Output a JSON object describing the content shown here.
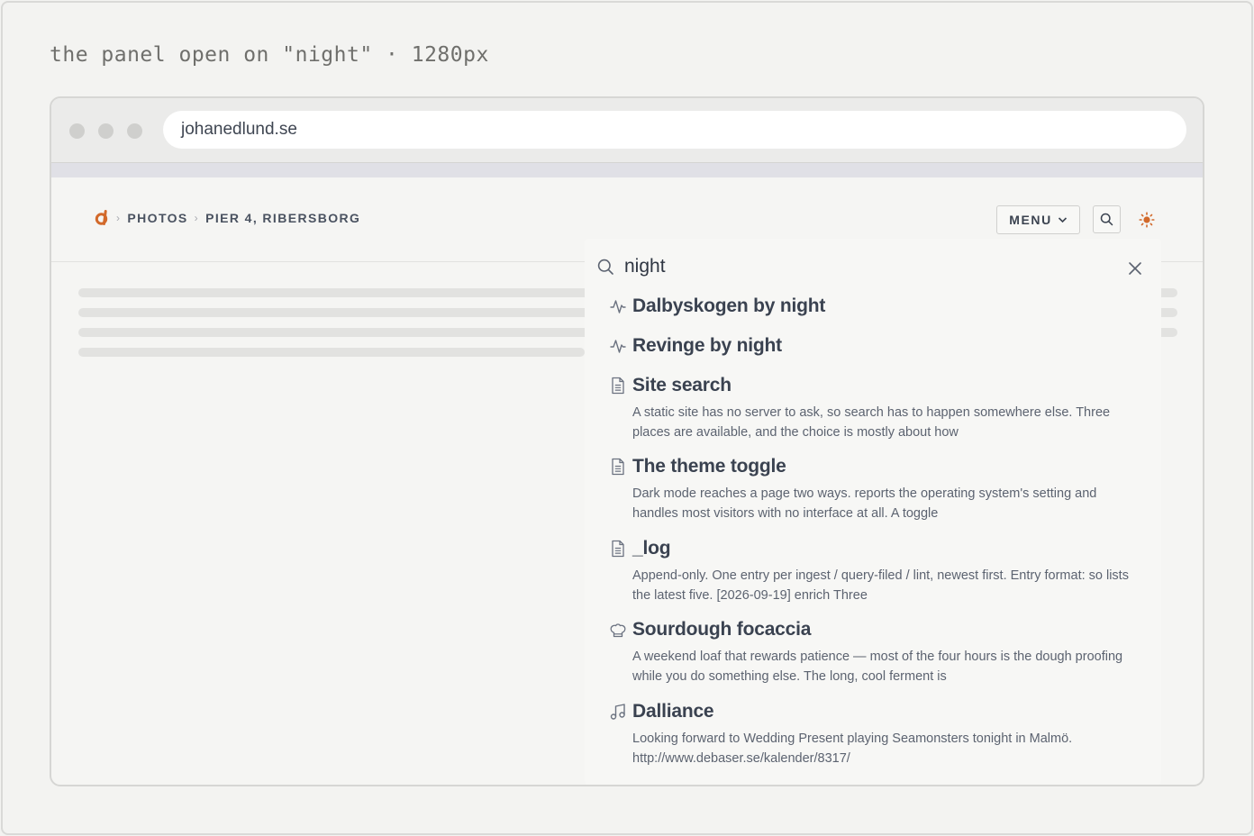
{
  "caption": "the panel open on \"night\" · 1280px",
  "browser": {
    "url": "johanedlund.se"
  },
  "header": {
    "breadcrumbs": [
      "PHOTOS",
      "PIER 4, RIBERSBORG"
    ],
    "menu_label": "MENU",
    "accent_color": "#d2692a"
  },
  "search": {
    "query": "night",
    "results": [
      {
        "icon": "activity-icon",
        "title": "Dalbyskogen by night",
        "description": ""
      },
      {
        "icon": "activity-icon",
        "title": "Revinge by night",
        "description": ""
      },
      {
        "icon": "document-icon",
        "title": "Site search",
        "description": "A static site has no server to ask, so search has to happen somewhere else. Three places are available, and the choice is mostly about how"
      },
      {
        "icon": "document-icon",
        "title": "The theme toggle",
        "description": "Dark mode reaches a page two ways. reports the operating system's setting and handles most visitors with no interface at all. A toggle"
      },
      {
        "icon": "document-icon",
        "title": "_log",
        "description": "Append-only. One entry per ingest / query-filed / lint, newest first. Entry format: so lists the latest five. [2026-09-19] enrich Three"
      },
      {
        "icon": "chef-hat-icon",
        "title": "Sourdough focaccia",
        "description": "A weekend loaf that rewards patience — most of the four hours is the dough proofing while you do something else. The long, cool ferment is"
      },
      {
        "icon": "music-icon",
        "title": "Dalliance",
        "description": "Looking forward to Wedding Present playing Seamonsters tonight in Malmö. http://www.debaser.se/kalender/8317/"
      }
    ]
  }
}
